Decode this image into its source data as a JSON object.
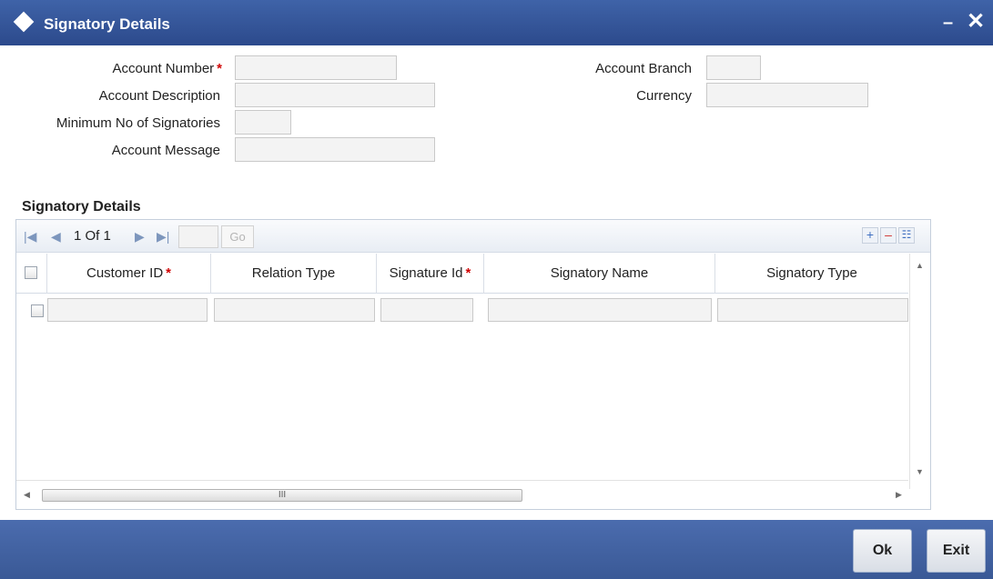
{
  "window": {
    "title": "Signatory Details",
    "minimize_glyph": "–",
    "close_glyph": "✕",
    "title_icon": "diamond-icon"
  },
  "form": {
    "account_number_label": "Account Number",
    "account_description_label": "Account Description",
    "min_signatories_label": "Minimum No of Signatories",
    "account_message_label": "Account Message",
    "account_branch_label": "Account Branch",
    "currency_label": "Currency",
    "required_marker": "*",
    "account_number_value": "",
    "account_description_value": "",
    "min_signatories_value": "",
    "account_message_value": "",
    "account_branch_value": "",
    "currency_value": ""
  },
  "grid": {
    "section_title": "Signatory Details",
    "pager": {
      "text": "1 Of 1",
      "go_label": "Go",
      "page_input_value": ""
    },
    "toolbar": {
      "add_glyph": "+",
      "delete_glyph": "–",
      "view_glyph": "☷"
    },
    "columns": {
      "customer_id": "Customer ID",
      "relation_type": "Relation Type",
      "signature_id": "Signature Id",
      "signatory_name": "Signatory Name",
      "signatory_type": "Signatory Type"
    },
    "required_marker": "*",
    "rows": [
      {
        "customer_id": "",
        "relation_type": "",
        "signature_id": "",
        "signatory_name": "",
        "signatory_type": ""
      }
    ],
    "scrollbar_grip": "III"
  },
  "footer": {
    "ok_label": "Ok",
    "exit_label": "Exit"
  },
  "colors": {
    "title_bar": "#3f63a8",
    "footer": "#4b6cae",
    "required": "#d00000"
  }
}
